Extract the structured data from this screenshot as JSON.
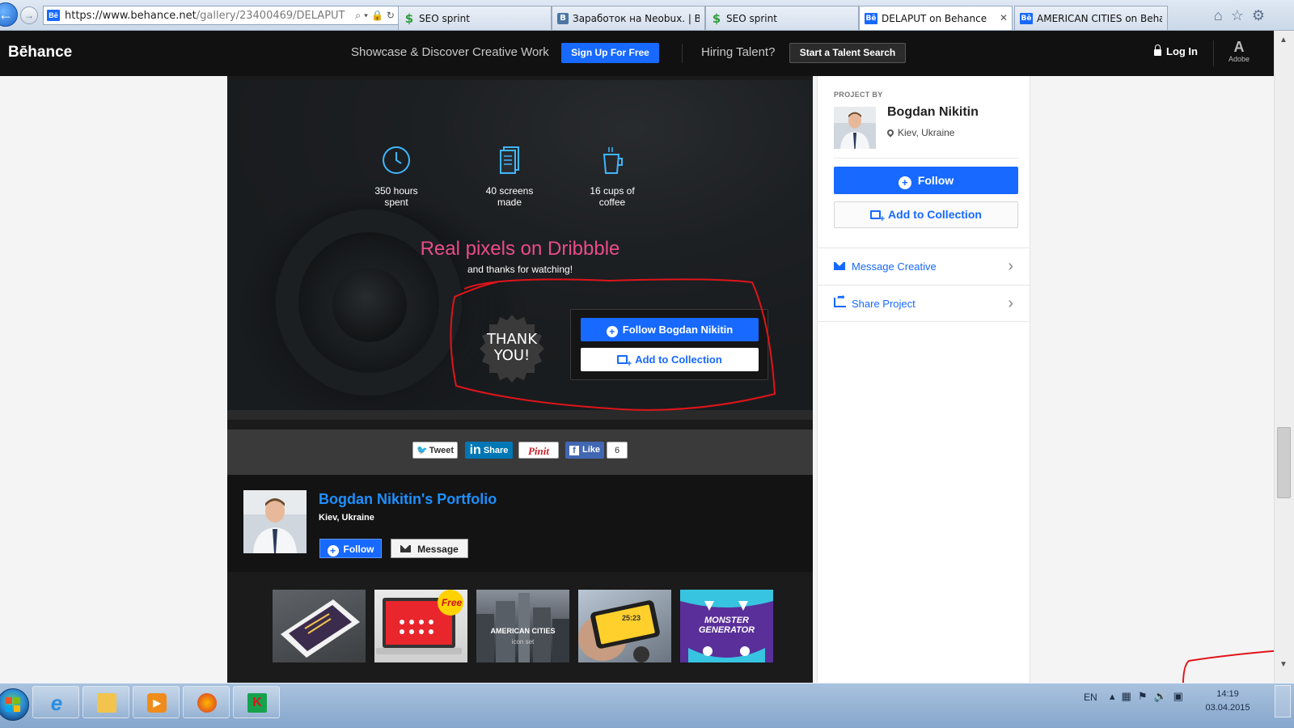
{
  "browser": {
    "url_host": "https://www.behance.net",
    "url_path": "/gallery/23400469/DELAPUT",
    "tabs": [
      {
        "label": "SEO sprint",
        "icon": "seosprint-favicon"
      },
      {
        "label": "Заработок на Neobux. | ВКо...",
        "icon": "vk-favicon"
      },
      {
        "label": "SEO sprint",
        "icon": "seosprint-favicon"
      },
      {
        "label": "DELAPUT on Behance",
        "icon": "behance-favicon",
        "active": true
      },
      {
        "label": "AMERICAN CITIES on Behance",
        "icon": "behance-favicon"
      }
    ]
  },
  "header": {
    "logo": "Bēhance",
    "tagline": "Showcase & Discover Creative Work",
    "signup_label": "Sign Up For Free",
    "hiring": "Hiring Talent?",
    "talent_label": "Start a Talent Search",
    "login_label": "Log In",
    "adobe_label": "Adobe",
    "adobe_mark": "A"
  },
  "hero": {
    "stats": [
      {
        "text": "350 hours\nspent",
        "icon": "clock-icon"
      },
      {
        "text": "40 screens\nmade",
        "icon": "screens-icon"
      },
      {
        "text": "16 cups of\ncoffee",
        "icon": "coffee-cup-icon"
      }
    ],
    "title": "Real pixels on Dribbble",
    "subtitle": "and thanks for watching!",
    "badge": "THANK\nYOU!",
    "follow_label": "Follow Bogdan Nikitin",
    "collect_label": "Add to Collection",
    "accent_color": "#ea4c89"
  },
  "share": {
    "tweet": "Tweet",
    "linkedin": "Share",
    "linkedin_mark": "in",
    "pinterest": "Pinit",
    "like": "Like",
    "facebook_mark": "f",
    "like_count": "6"
  },
  "portfolio": {
    "name": "Bogdan Nikitin's Portfolio",
    "location": "Kiev, Ukraine",
    "follow_label": "Follow",
    "message_label": "Message",
    "thumbnails": [
      {
        "label": ""
      },
      {
        "label": "Free"
      },
      {
        "label": "AMERICAN CITIES",
        "sub": "icon set"
      },
      {
        "label": "25:23"
      },
      {
        "label": "MONSTER\nGENERATOR"
      }
    ]
  },
  "sidebar": {
    "project_by": "PROJECT BY",
    "name": "Bogdan Nikitin",
    "location": "Kiev, Ukraine",
    "follow_label": "Follow",
    "collect_label": "Add to Collection",
    "message_label": "Message Creative",
    "share_label": "Share Project"
  },
  "taskbar": {
    "lang": "EN",
    "time": "14:19",
    "date": "03.04.2015"
  },
  "colors": {
    "brand_blue": "#1769ff",
    "header_bg": "#111111",
    "annotation": "#e0141b"
  }
}
